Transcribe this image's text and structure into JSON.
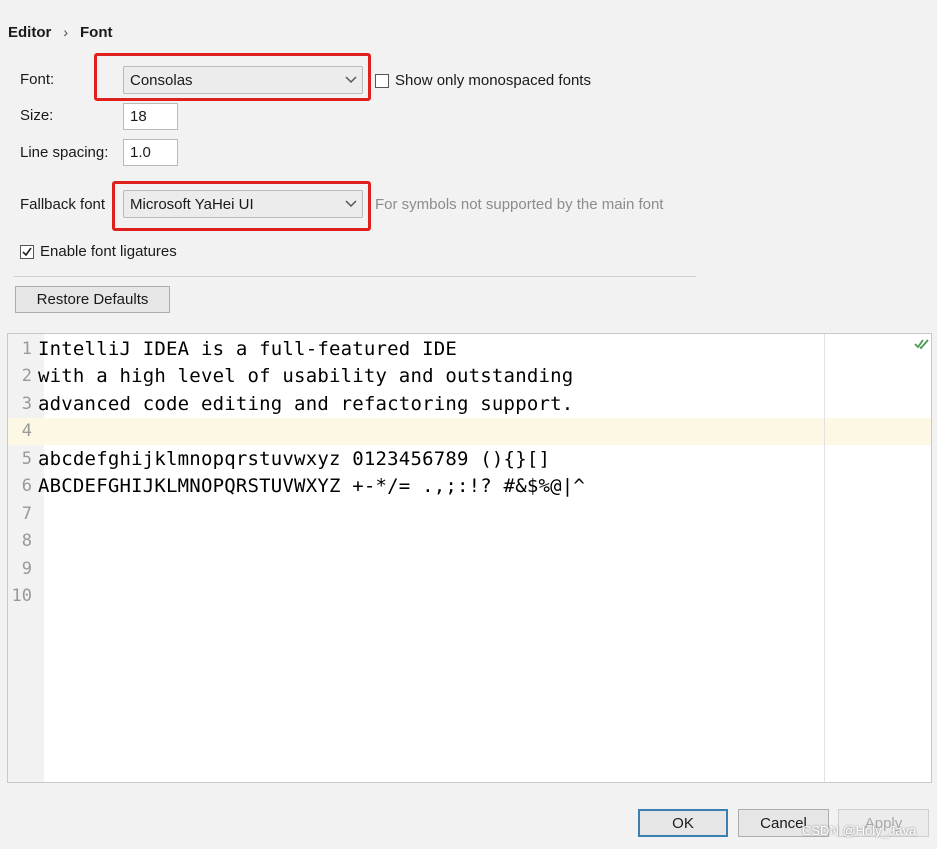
{
  "breadcrumb": {
    "parent": "Editor",
    "separator": "›",
    "current": "Font"
  },
  "font": {
    "label": "Font:",
    "value": "Consolas"
  },
  "monospaced": {
    "label": "Show only monospaced fonts",
    "checked": false
  },
  "size": {
    "label": "Size:",
    "value": "18"
  },
  "line_spacing": {
    "label": "Line spacing:",
    "value": "1.0"
  },
  "fallback": {
    "label": "Fallback font",
    "value": "Microsoft YaHei UI",
    "hint": "For symbols not supported by the main font"
  },
  "ligatures": {
    "label": "Enable font ligatures",
    "checked": true
  },
  "restore_defaults": "Restore Defaults",
  "preview": {
    "lines": [
      {
        "num": "1",
        "text": "IntelliJ IDEA is a full-featured IDE"
      },
      {
        "num": "2",
        "text": "with a high level of usability and outstanding"
      },
      {
        "num": "3",
        "text": "advanced code editing and refactoring support."
      },
      {
        "num": "4",
        "text": ""
      },
      {
        "num": "5",
        "text": "abcdefghijklmnopqrstuvwxyz 0123456789 (){}[]"
      },
      {
        "num": "6",
        "text": "ABCDEFGHIJKLMNOPQRSTUVWXYZ +-*/= .,;:!? #&$%@|^"
      },
      {
        "num": "7",
        "text": ""
      },
      {
        "num": "8",
        "text": ""
      },
      {
        "num": "9",
        "text": ""
      },
      {
        "num": "10",
        "text": ""
      }
    ],
    "status_icon": "double-check-icon"
  },
  "footer": {
    "ok": "OK",
    "cancel": "Cancel",
    "apply": "Apply"
  },
  "watermark": "CSDN @Holy_Java",
  "colors": {
    "highlight": "#e0201c",
    "caret_line": "#fdf8e3",
    "ok_border": "#3c7fb1"
  }
}
